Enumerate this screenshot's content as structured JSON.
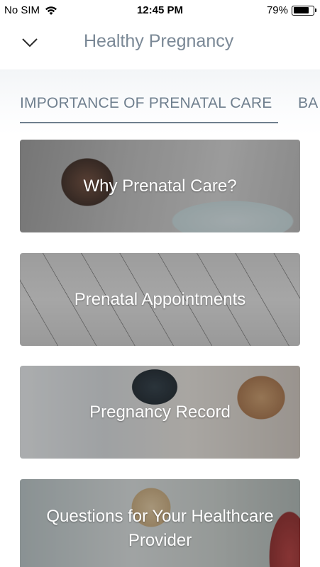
{
  "status_bar": {
    "carrier": "No SIM",
    "time": "12:45 PM",
    "battery_percent": "79%",
    "battery_level": 0.79
  },
  "nav": {
    "title": "Healthy Pregnancy",
    "back_icon": "chevron-down-icon"
  },
  "tabs": [
    {
      "label": "IMPORTANCE OF PRENATAL CARE",
      "active": true
    },
    {
      "label": "BA",
      "active": false
    }
  ],
  "cards": [
    {
      "label": "Why Prenatal Care?"
    },
    {
      "label": "Prenatal Appointments"
    },
    {
      "label": "Pregnancy Record"
    },
    {
      "label": "Questions for Your Healthcare Provider"
    }
  ],
  "colors": {
    "title_gray": "#7a8896",
    "tab_gray": "#6f7f8e",
    "card_overlay": "#282828"
  }
}
